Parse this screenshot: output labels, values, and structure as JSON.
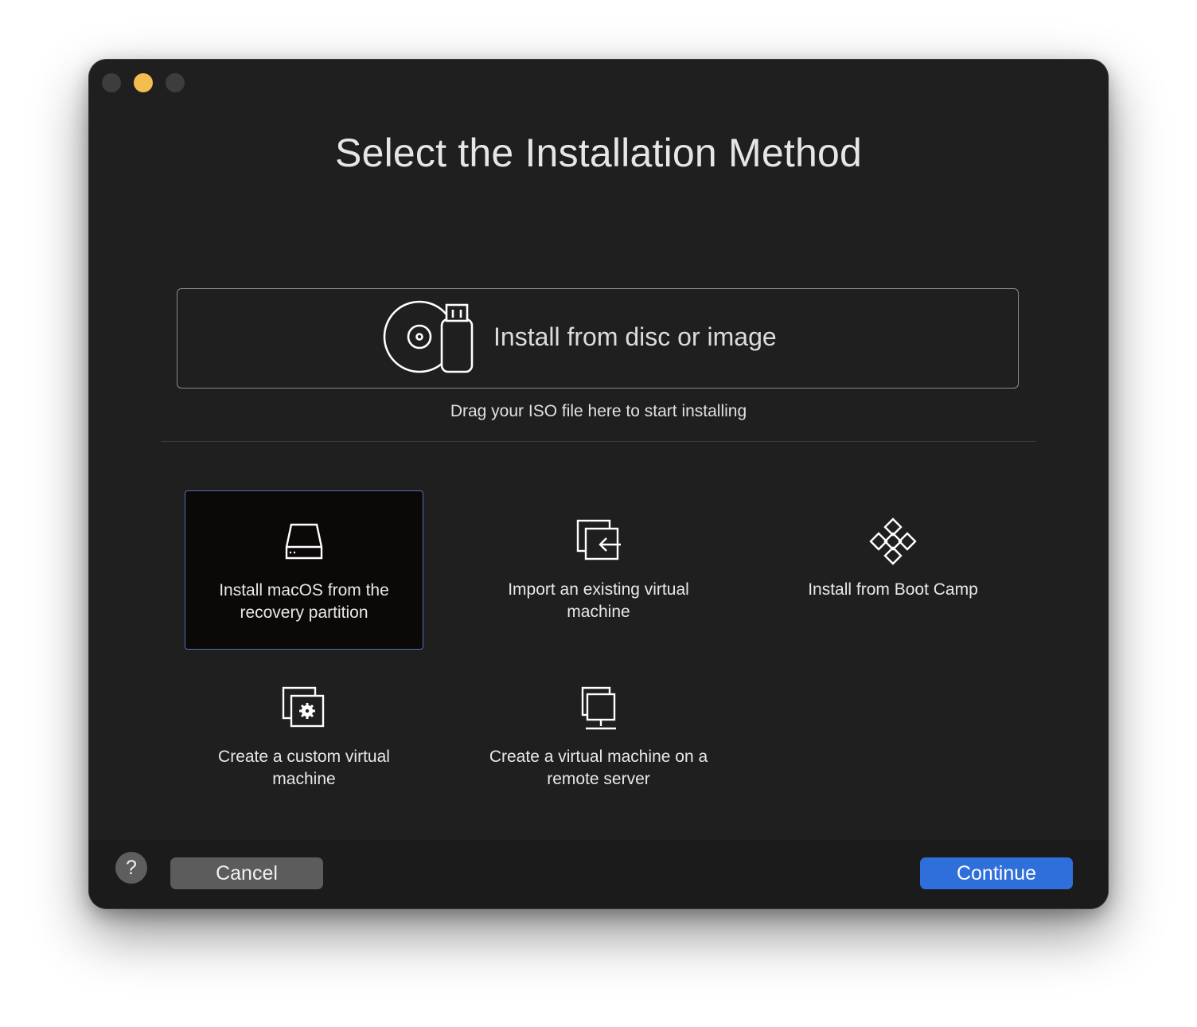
{
  "window": {
    "title": "Select the Installation Method"
  },
  "dropzone": {
    "label": "Install from disc or image",
    "hint": "Drag your ISO file here to start installing",
    "icon": "disc-usb-icon"
  },
  "options": [
    {
      "label": "Install macOS from the recovery partition",
      "icon": "hard-drive-icon",
      "selected": true
    },
    {
      "label": "Import an existing virtual machine",
      "icon": "import-icon",
      "selected": false
    },
    {
      "label": "Install from Boot Camp",
      "icon": "boot-camp-icon",
      "selected": false
    },
    {
      "label": "Create a custom virtual machine",
      "icon": "custom-vm-icon",
      "selected": false
    },
    {
      "label": "Create a virtual machine on a remote server",
      "icon": "remote-server-icon",
      "selected": false
    }
  ],
  "footer": {
    "help_label": "?",
    "cancel_label": "Cancel",
    "continue_label": "Continue"
  },
  "colors": {
    "window_bg": "#1f1f1f",
    "accent": "#2f6fdc",
    "selected_border": "#4f6db8",
    "minimize_dot": "#f4bd4f"
  }
}
